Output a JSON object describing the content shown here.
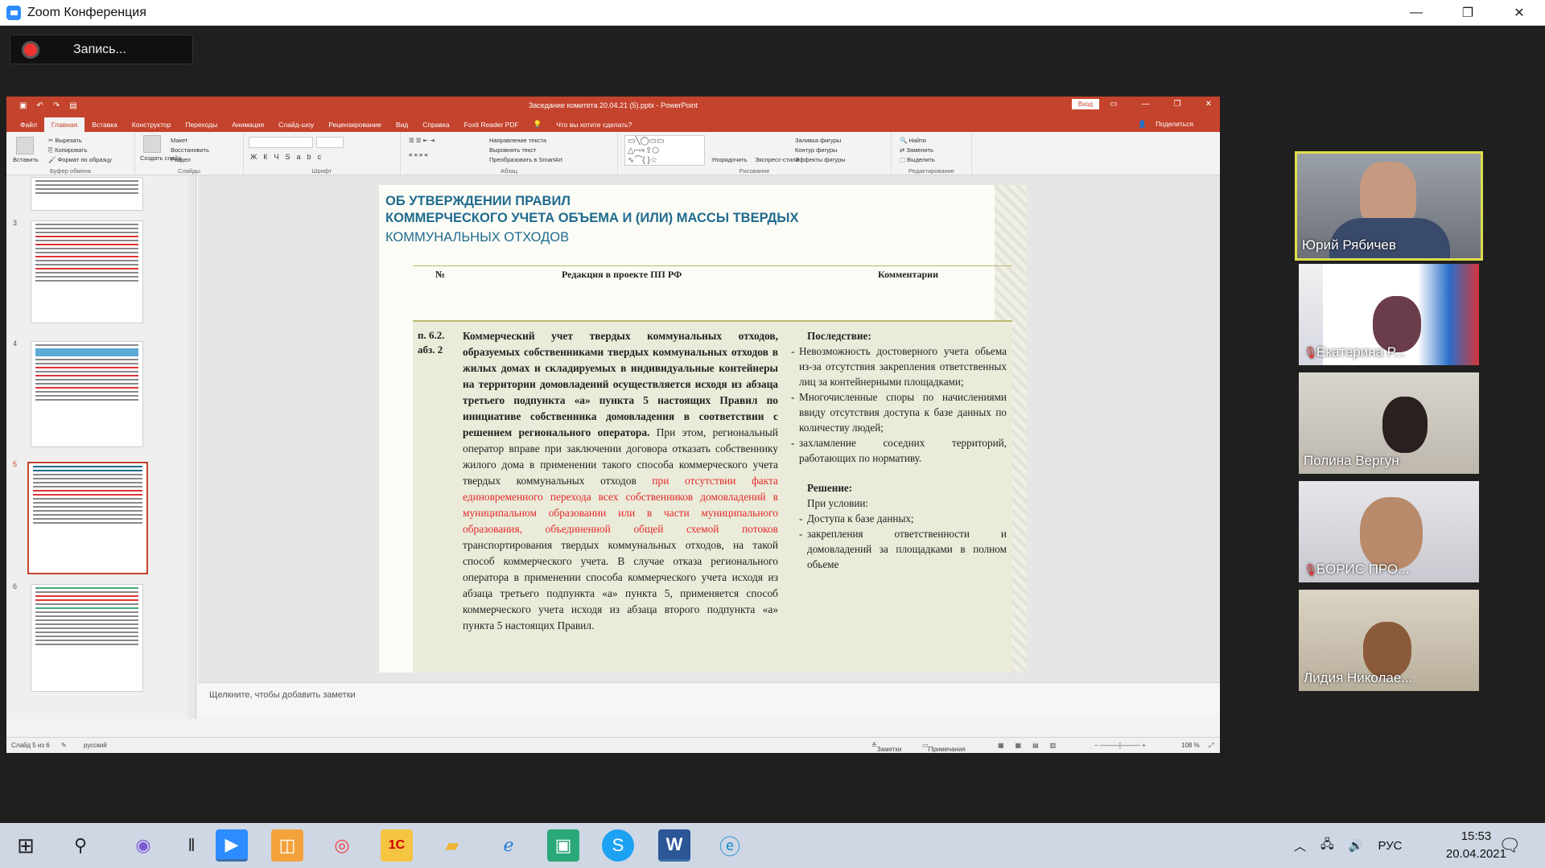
{
  "zoom": {
    "window_title": "Zoom Конференция",
    "recording_label": "Запись..."
  },
  "ppt": {
    "title": "Заседание комитета 20.04.21 (5).pptx - PowerPoint",
    "login_button": "Вход",
    "tabs": [
      "Файл",
      "Главная",
      "Вставка",
      "Конструктор",
      "Переходы",
      "Анимация",
      "Слайд-шоу",
      "Рецензирование",
      "Вид",
      "Справка",
      "Foxit Reader PDF"
    ],
    "search_hint": "Что вы хотите сделать?",
    "share": "Поделиться",
    "ribbon": {
      "clipboard": {
        "paste": "Вставить",
        "cut": "Вырезать",
        "copy": "Копировать",
        "format_painter": "Формат по образцу",
        "label": "Буфер обмена"
      },
      "slides": {
        "new_slide": "Создать слайд",
        "layout": "Макет",
        "reset": "Восстановить",
        "section": "Раздел",
        "label": "Слайды"
      },
      "font": {
        "label": "Шрифт"
      },
      "paragraph": {
        "text_direction": "Направление текста",
        "align_text": "Выровнять текст",
        "smartart": "Преобразовать в SmartArt",
        "label": "Абзац"
      },
      "drawing": {
        "arrange": "Упорядочить",
        "quick_styles": "Экспресс-стили",
        "shape_fill": "Заливка фигуры",
        "shape_outline": "Контур фигуры",
        "shape_effects": "Эффекты фигуры",
        "label": "Рисование"
      },
      "editing": {
        "find": "Найти",
        "replace": "Заменить",
        "select": "Выделить",
        "label": "Редактирование"
      }
    },
    "thumbnails": [
      "3",
      "4",
      "5",
      "6"
    ],
    "slide": {
      "title_line1": "ОБ УТВЕРЖДЕНИИ ПРАВИЛ",
      "title_line2": "КОММЕРЧЕСКОГО УЧЕТА ОБЪЕМА И (ИЛИ) МАССЫ ТВЕРДЫХ",
      "title_line3": "КОММУНАЛЬНЫХ ОТХОДОВ",
      "col_num": "№",
      "col_edition": "Редакция в проекте ПП РФ",
      "col_comments": "Комментарии",
      "row_num": "п. 6.2. абз. 2",
      "body_bold": "Коммерческий учет твердых коммунальных отходов, образуемых собственниками твердых коммунальных отходов в жилых домах и складируемых в индивидуальные контейнеры на территории домовладений осуществляется исходя из абзаца третьего подпункта «а» пункта 5 настоящих Правил по инициативе собственника домовладения в соответствии с решением регионального оператора.",
      "body_normal1": " При этом, региональный оператор вправе при заключении договора отказать собственнику жилого дома в применении такого способа коммерческого учета твердых коммунальных отходов ",
      "body_red": "при отсутствии факта единовременного перехода всех собственников домовладений в муниципальном образовании или в части муниципального образования, объединенной общей схемой потоков",
      "body_normal2": " транспортирования твердых коммунальных отходов, на такой способ коммерческого учета. В случае отказа регионального оператора в применении способа коммерческого учета исходя из абзаца третьего подпункта «а» пункта 5, применяется способ коммерческого учета исходя из абзаца второго подпункта «а» пункта 5 настоящих Правил.",
      "consequence_heading": "Последствие:",
      "consequences": [
        "Невозможность достоверного учета обьема из-за отсутствия закрепления ответственных лиц за контейнерными площадками;",
        "Многочисленные споры по начислениями ввиду отсутствия доступа к базе данных по количеству людей;",
        "захламление соседних территорий, работающих по нормативу."
      ],
      "solution_heading": "Решение:",
      "solution_sub": "При условии:",
      "solutions": [
        "Доступа к базе данных;",
        "закрепления ответственности и домовладений за площадками в полном обьеме"
      ]
    },
    "notes_placeholder": "Щелкните, чтобы добавить заметки",
    "status": {
      "slide_info": "Слайд 5 из 6",
      "language": "русский",
      "notes": "Заметки",
      "comments": "Примечания",
      "zoom": "108 %"
    }
  },
  "participants": [
    {
      "name": "Юрий Рябичев",
      "muted": false,
      "active": true
    },
    {
      "name": "Екатерина Р...",
      "muted": true,
      "active": false
    },
    {
      "name": "Полина Вергун",
      "muted": false,
      "active": false
    },
    {
      "name": "БОРИС ПРО...",
      "muted": true,
      "active": false
    },
    {
      "name": "Лидия Николае...",
      "muted": false,
      "active": false
    }
  ],
  "taskbar": {
    "language": "РУС",
    "time": "15:53",
    "date": "20.04.2021"
  }
}
